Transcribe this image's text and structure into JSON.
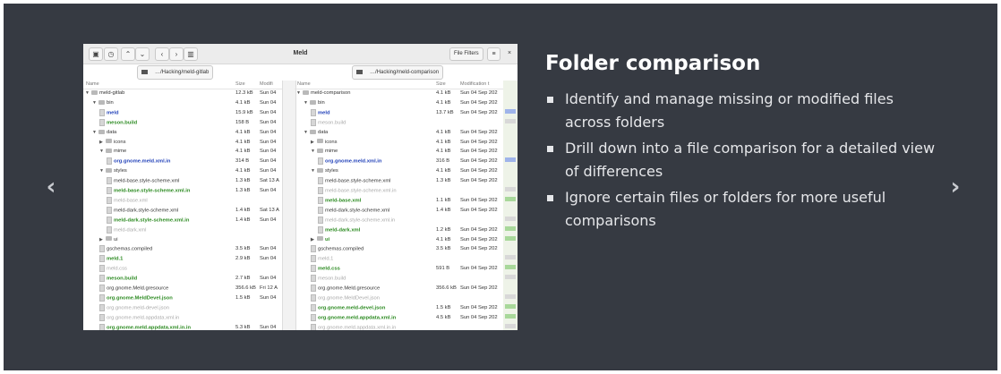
{
  "carousel": {
    "prev_glyph": "‹",
    "next_glyph": "›"
  },
  "window": {
    "title": "Meld",
    "file_filters_label": "File Filters",
    "menu_glyph": "≡",
    "close_glyph": "×",
    "toolbar_icons": [
      "save-icon",
      "history-icon",
      "up-icon",
      "down-icon",
      "back-icon",
      "forward-icon",
      "trash-icon"
    ],
    "left_path": "…/Hacking/meld-gitlab",
    "right_path": "…/Hacking/meld-comparison"
  },
  "columns": {
    "left": {
      "name": "Name",
      "size": "Size",
      "modified": "Modifi"
    },
    "right": {
      "name": "Name",
      "size": "Size",
      "modified": "Modification t"
    }
  },
  "left_rows": [
    {
      "indent": 0,
      "kind": "folder",
      "open": true,
      "state": "normal",
      "name": "meld-gitlab",
      "size": "12.3 kB",
      "mod": "Sun 04"
    },
    {
      "indent": 1,
      "kind": "folder",
      "open": true,
      "state": "normal",
      "name": "bin",
      "size": "4.1 kB",
      "mod": "Sun 04"
    },
    {
      "indent": 2,
      "kind": "file",
      "state": "modified",
      "name": "meld",
      "size": "15.9 kB",
      "mod": "Sun 04"
    },
    {
      "indent": 2,
      "kind": "file",
      "state": "new",
      "name": "meson.build",
      "size": "158 B",
      "mod": "Sun 04"
    },
    {
      "indent": 1,
      "kind": "folder",
      "open": true,
      "state": "normal",
      "name": "data",
      "size": "4.1 kB",
      "mod": "Sun 04"
    },
    {
      "indent": 2,
      "kind": "folder",
      "open": false,
      "state": "normal",
      "name": "icons",
      "size": "4.1 kB",
      "mod": "Sun 04"
    },
    {
      "indent": 2,
      "kind": "folder",
      "open": true,
      "state": "normal",
      "name": "mime",
      "size": "4.1 kB",
      "mod": "Sun 04"
    },
    {
      "indent": 3,
      "kind": "file",
      "state": "modified",
      "name": "org.gnome.meld.xml.in",
      "size": "314 B",
      "mod": "Sun 04"
    },
    {
      "indent": 2,
      "kind": "folder",
      "open": true,
      "state": "normal",
      "name": "styles",
      "size": "4.1 kB",
      "mod": "Sun 04"
    },
    {
      "indent": 3,
      "kind": "file",
      "state": "normal",
      "name": "meld-base.style-scheme.xml",
      "size": "1.3 kB",
      "mod": "Sat 13 A"
    },
    {
      "indent": 3,
      "kind": "file",
      "state": "new",
      "name": "meld-base.style-scheme.xml.in",
      "size": "1.3 kB",
      "mod": "Sun 04"
    },
    {
      "indent": 3,
      "kind": "file",
      "state": "missing",
      "name": "meld-base.xml",
      "size": "",
      "mod": ""
    },
    {
      "indent": 3,
      "kind": "file",
      "state": "normal",
      "name": "meld-dark.style-scheme.xml",
      "size": "1.4 kB",
      "mod": "Sat 13 A"
    },
    {
      "indent": 3,
      "kind": "file",
      "state": "new",
      "name": "meld-dark.style-scheme.xml.in",
      "size": "1.4 kB",
      "mod": "Sun 04"
    },
    {
      "indent": 3,
      "kind": "file",
      "state": "missing",
      "name": "meld-dark.xml",
      "size": "",
      "mod": ""
    },
    {
      "indent": 2,
      "kind": "folder",
      "open": false,
      "state": "normal",
      "name": "ui",
      "size": "",
      "mod": ""
    },
    {
      "indent": 2,
      "kind": "file",
      "state": "normal",
      "name": "gschemas.compiled",
      "size": "3.5 kB",
      "mod": "Sun 04"
    },
    {
      "indent": 2,
      "kind": "file",
      "state": "new",
      "name": "meld.1",
      "size": "2.9 kB",
      "mod": "Sun 04"
    },
    {
      "indent": 2,
      "kind": "file",
      "state": "missing",
      "name": "meld.css",
      "size": "",
      "mod": ""
    },
    {
      "indent": 2,
      "kind": "file",
      "state": "new",
      "name": "meson.build",
      "size": "2.7 kB",
      "mod": "Sun 04"
    },
    {
      "indent": 2,
      "kind": "file",
      "state": "normal",
      "name": "org.gnome.Meld.gresource",
      "size": "356.6 kB",
      "mod": "Fri 12 A"
    },
    {
      "indent": 2,
      "kind": "file",
      "state": "new",
      "name": "org.gnome.MeldDevel.json",
      "size": "1.5 kB",
      "mod": "Sun 04"
    },
    {
      "indent": 2,
      "kind": "file",
      "state": "missing",
      "name": "org.gnome.meld-devel.json",
      "size": "",
      "mod": ""
    },
    {
      "indent": 2,
      "kind": "file",
      "state": "missing",
      "name": "org.gnome.meld.appdata.xml.in",
      "size": "",
      "mod": ""
    },
    {
      "indent": 2,
      "kind": "file",
      "state": "new",
      "name": "org.gnome.meld.appdata.xml.in.in",
      "size": "5.3 kB",
      "mod": "Sun 04"
    }
  ],
  "right_rows": [
    {
      "indent": 0,
      "kind": "folder",
      "open": true,
      "state": "normal",
      "name": "meld-comparison",
      "size": "4.1 kB",
      "mod": "Sun 04 Sep 202"
    },
    {
      "indent": 1,
      "kind": "folder",
      "open": true,
      "state": "normal",
      "name": "bin",
      "size": "4.1 kB",
      "mod": "Sun 04 Sep 202"
    },
    {
      "indent": 2,
      "kind": "file",
      "state": "modified",
      "name": "meld",
      "size": "13.7 kB",
      "mod": "Sun 04 Sep 202"
    },
    {
      "indent": 2,
      "kind": "file",
      "state": "missing",
      "name": "meson.build",
      "size": "",
      "mod": ""
    },
    {
      "indent": 1,
      "kind": "folder",
      "open": true,
      "state": "normal",
      "name": "data",
      "size": "4.1 kB",
      "mod": "Sun 04 Sep 202"
    },
    {
      "indent": 2,
      "kind": "folder",
      "open": false,
      "state": "normal",
      "name": "icons",
      "size": "4.1 kB",
      "mod": "Sun 04 Sep 202"
    },
    {
      "indent": 2,
      "kind": "folder",
      "open": true,
      "state": "normal",
      "name": "mime",
      "size": "4.1 kB",
      "mod": "Sun 04 Sep 202"
    },
    {
      "indent": 3,
      "kind": "file",
      "state": "modified",
      "name": "org.gnome.meld.xml.in",
      "size": "316 B",
      "mod": "Sun 04 Sep 202"
    },
    {
      "indent": 2,
      "kind": "folder",
      "open": true,
      "state": "normal",
      "name": "styles",
      "size": "4.1 kB",
      "mod": "Sun 04 Sep 202"
    },
    {
      "indent": 3,
      "kind": "file",
      "state": "normal",
      "name": "meld-base.style-scheme.xml",
      "size": "1.3 kB",
      "mod": "Sun 04 Sep 202"
    },
    {
      "indent": 3,
      "kind": "file",
      "state": "missing",
      "name": "meld-base.style-scheme.xml.in",
      "size": "",
      "mod": ""
    },
    {
      "indent": 3,
      "kind": "file",
      "state": "new",
      "name": "meld-base.xml",
      "size": "1.1 kB",
      "mod": "Sun 04 Sep 202"
    },
    {
      "indent": 3,
      "kind": "file",
      "state": "normal",
      "name": "meld-dark.style-scheme.xml",
      "size": "1.4 kB",
      "mod": "Sun 04 Sep 202"
    },
    {
      "indent": 3,
      "kind": "file",
      "state": "missing",
      "name": "meld-dark.style-scheme.xml.in",
      "size": "",
      "mod": ""
    },
    {
      "indent": 3,
      "kind": "file",
      "state": "new",
      "name": "meld-dark.xml",
      "size": "1.2 kB",
      "mod": "Sun 04 Sep 202"
    },
    {
      "indent": 2,
      "kind": "folder",
      "open": false,
      "state": "new",
      "name": "ui",
      "size": "4.1 kB",
      "mod": "Sun 04 Sep 202"
    },
    {
      "indent": 2,
      "kind": "file",
      "state": "normal",
      "name": "gschemas.compiled",
      "size": "3.5 kB",
      "mod": "Sun 04 Sep 202"
    },
    {
      "indent": 2,
      "kind": "file",
      "state": "missing",
      "name": "meld.1",
      "size": "",
      "mod": ""
    },
    {
      "indent": 2,
      "kind": "file",
      "state": "new",
      "name": "meld.css",
      "size": "591 B",
      "mod": "Sun 04 Sep 202"
    },
    {
      "indent": 2,
      "kind": "file",
      "state": "missing",
      "name": "meson.build",
      "size": "",
      "mod": ""
    },
    {
      "indent": 2,
      "kind": "file",
      "state": "normal",
      "name": "org.gnome.Meld.gresource",
      "size": "356.6 kB",
      "mod": "Sun 04 Sep 202"
    },
    {
      "indent": 2,
      "kind": "file",
      "state": "missing",
      "name": "org.gnome.MeldDevel.json",
      "size": "",
      "mod": ""
    },
    {
      "indent": 2,
      "kind": "file",
      "state": "new",
      "name": "org.gnome.meld-devel.json",
      "size": "1.5 kB",
      "mod": "Sun 04 Sep 202"
    },
    {
      "indent": 2,
      "kind": "file",
      "state": "new",
      "name": "org.gnome.meld.appdata.xml.in",
      "size": "4.5 kB",
      "mod": "Sun 04 Sep 202"
    },
    {
      "indent": 2,
      "kind": "file",
      "state": "missing",
      "name": "org.gnome.meld.appdata.xml.in.in",
      "size": "",
      "mod": ""
    }
  ],
  "feature": {
    "title": "Folder comparison",
    "bullets": [
      "Identify and manage missing or modified files across folders",
      "Drill down into a file comparison for a detailed view of differences",
      "Ignore certain files or folders for more useful comparisons"
    ]
  },
  "colors": {
    "background": "#363a42",
    "modified": "#1f3fb8",
    "new": "#2b8a20",
    "missing": "#a9a9a9"
  }
}
